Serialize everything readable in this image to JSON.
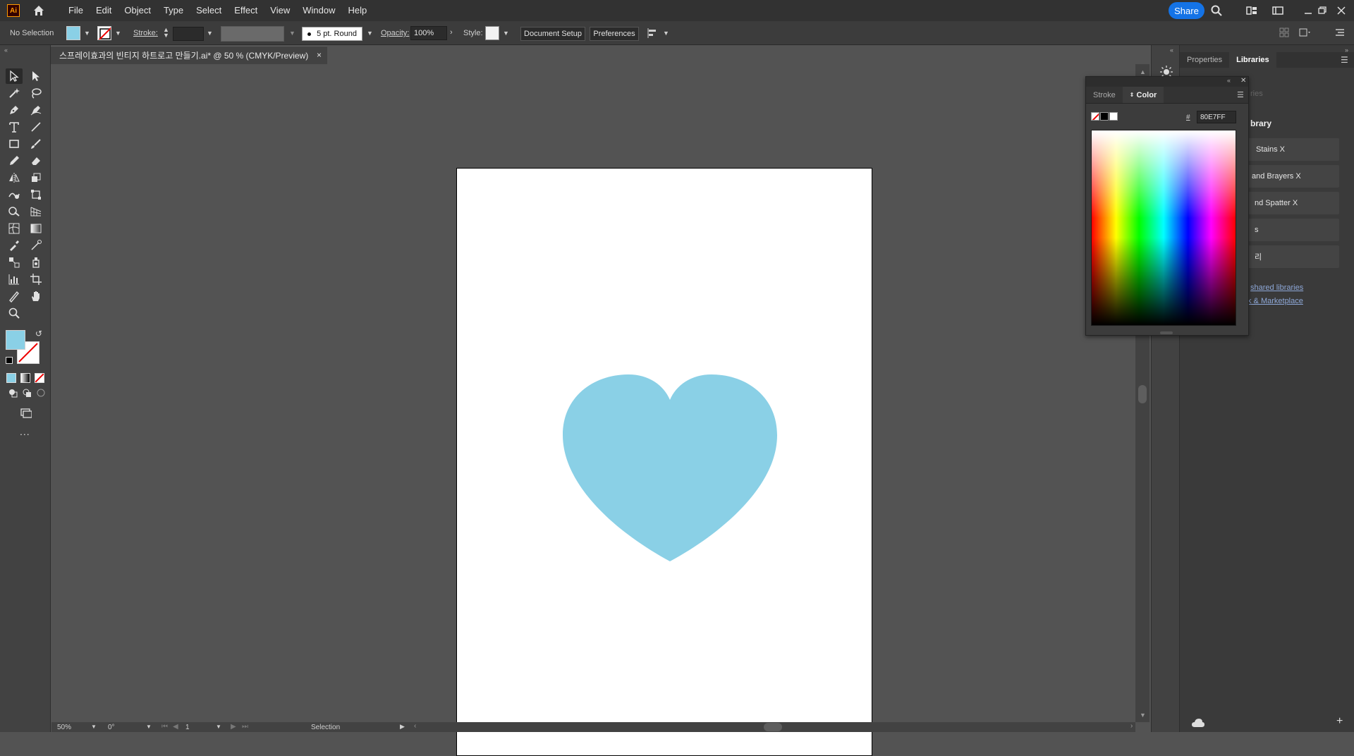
{
  "menubar": {
    "logo": "Ai",
    "items": [
      "File",
      "Edit",
      "Object",
      "Type",
      "Select",
      "Effect",
      "View",
      "Window",
      "Help"
    ],
    "share_label": "Share"
  },
  "controlbar": {
    "selection_status": "No Selection",
    "stroke_label": "Stroke:",
    "brush_label": "5 pt. Round",
    "opacity_label": "Opacity:",
    "opacity_value": "100%",
    "style_label": "Style:",
    "document_setup_label": "Document Setup",
    "preferences_label": "Preferences"
  },
  "document": {
    "tab_title": "스프레이효과의 빈티지 하트로고 만들기.ai* @ 50 % (CMYK/Preview)",
    "close_glyph": "×"
  },
  "colors": {
    "fill": "#8ad0e6",
    "heart": "#8ad0e6",
    "accent": "#1473e6"
  },
  "toolbar": {
    "more_glyph": "..."
  },
  "statusbar": {
    "zoom": "50%",
    "rotation": "0°",
    "artboard_number": "1",
    "tool_name": "Selection"
  },
  "right_panel": {
    "tabs": [
      "Properties",
      "Libraries"
    ],
    "faded_header": "ries",
    "library_heading": "brary",
    "items": [
      "Stains X",
      "and Brayers X",
      "nd Spatter X",
      "s",
      "리"
    ],
    "links": [
      "shared libraries",
      "k & Marketplace"
    ]
  },
  "color_panel": {
    "tabs": [
      "Stroke",
      "Color"
    ],
    "hash_label": "#",
    "hex_value": "80E7FF"
  }
}
